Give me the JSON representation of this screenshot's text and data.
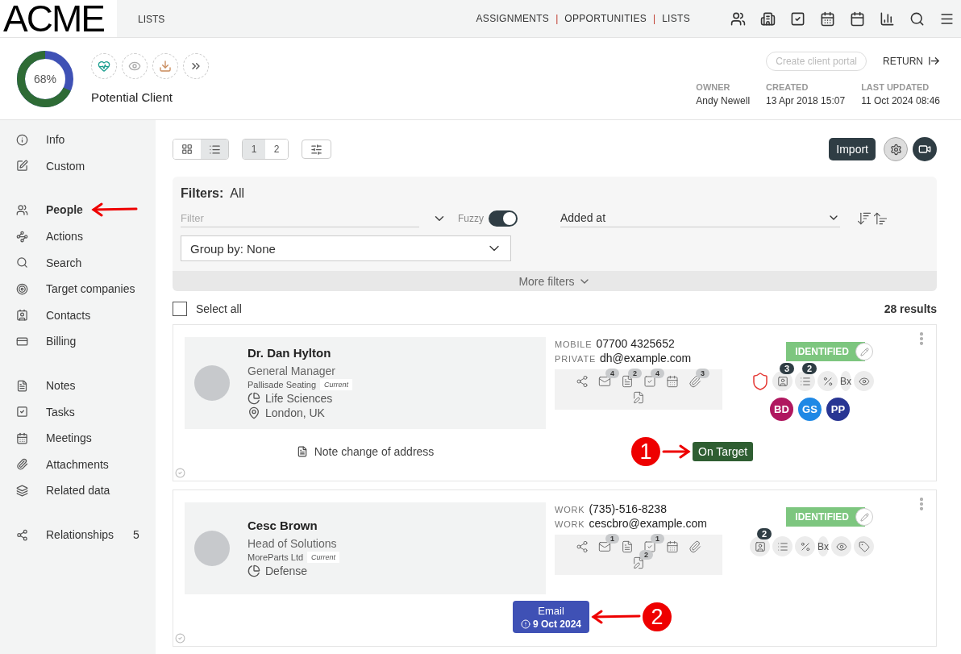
{
  "header": {
    "logo": "ACME",
    "section": "LISTS",
    "nav": [
      {
        "kind": "link",
        "label": "ASSIGNMENTS"
      },
      {
        "kind": "separator",
        "label": "|"
      },
      {
        "kind": "link",
        "label": "OPPORTUNITIES"
      },
      {
        "kind": "separator",
        "label": "|"
      },
      {
        "kind": "link",
        "label": "LISTS"
      }
    ]
  },
  "record": {
    "progress": {
      "level": 0.68,
      "reading": "68%"
    },
    "status": "Potential Client",
    "portal_button": {
      "label": "Create client portal",
      "disabled": true
    },
    "return_label": "RETURN",
    "meta": [
      {
        "label": "OWNER",
        "value": "Andy Newell"
      },
      {
        "label": "CREATED",
        "value": "13 Apr 2018 15:07"
      },
      {
        "label": "LAST UPDATED",
        "value": "11 Oct 2024 08:46"
      }
    ]
  },
  "sidebar": {
    "groups": [
      [
        {
          "label": "Info",
          "selected": false
        },
        {
          "label": "Custom",
          "selected": false
        }
      ],
      [
        {
          "label": "People",
          "selected": true,
          "annotated": true
        },
        {
          "label": "Actions",
          "selected": false
        },
        {
          "label": "Search",
          "selected": false
        },
        {
          "label": "Target companies",
          "selected": false
        },
        {
          "label": "Contacts",
          "selected": false
        },
        {
          "label": "Billing",
          "selected": false
        }
      ],
      [
        {
          "label": "Notes",
          "selected": false
        },
        {
          "label": "Tasks",
          "selected": false
        },
        {
          "label": "Meetings",
          "selected": false
        },
        {
          "label": "Attachments",
          "selected": false
        },
        {
          "label": "Related data",
          "selected": false
        }
      ],
      [
        {
          "label": "Relationships",
          "selected": false,
          "count": "5"
        }
      ]
    ]
  },
  "toolbar": {
    "views": [
      {
        "kind": "grid",
        "selected": false
      },
      {
        "kind": "list",
        "selected": true
      }
    ],
    "pages": [
      {
        "label": "1",
        "selected": true
      },
      {
        "label": "2",
        "selected": false
      }
    ],
    "import_label": "Import"
  },
  "filters": {
    "title": "Filters:",
    "value": "All",
    "filter_placeholder": "Filter",
    "fuzzy": {
      "label": "Fuzzy",
      "on": true
    },
    "sort": "Added at",
    "group_by": "Group by: None",
    "more_label": "More filters"
  },
  "select_all": {
    "label": "Select all",
    "checked": false
  },
  "results": "28 results",
  "people": [
    {
      "name": "Dr. Dan Hylton",
      "title": "General Manager",
      "company": "Pallisade Seating",
      "company_tag": "Current",
      "industry": "Life Sciences",
      "location": "London, UK",
      "contacts": [
        {
          "type": "MOBILE",
          "value": "07700 4325652"
        },
        {
          "type": "PRIVATE",
          "value": "dh@example.com"
        }
      ],
      "activity": [
        {
          "kind": "relationships"
        },
        {
          "kind": "email",
          "count": "4"
        },
        {
          "kind": "document",
          "count": "2"
        },
        {
          "kind": "task",
          "count": "4"
        },
        {
          "kind": "calendar"
        },
        {
          "kind": "attachment",
          "count": "3"
        },
        {
          "kind": "signature"
        }
      ],
      "status": "IDENTIFIED",
      "tags": [
        {
          "kind": "shield"
        },
        {
          "kind": "contact",
          "count": "3"
        },
        {
          "kind": "list",
          "count": "2"
        },
        {
          "kind": "percent"
        },
        {
          "kind": "text",
          "label": "Bx"
        },
        {
          "kind": "eye"
        }
      ],
      "owners": [
        {
          "initials": "BD",
          "color": "#b0175f"
        },
        {
          "initials": "GS",
          "color": "#1e88e5"
        },
        {
          "initials": "PP",
          "color": "#283593"
        }
      ],
      "note": "Note change of address",
      "action": {
        "kind": "badge",
        "label": "On Target"
      },
      "callout": {
        "number": "1",
        "kind": "points_right"
      }
    },
    {
      "name": "Cesc Brown",
      "title": "Head of Solutions",
      "company": "MoreParts Ltd",
      "company_tag": "Current",
      "industry": "Defense",
      "contacts": [
        {
          "type": "WORK",
          "value": "(735)-516-8238"
        },
        {
          "type": "WORK",
          "value": "cescbro@example.com"
        }
      ],
      "activity": [
        {
          "kind": "relationships"
        },
        {
          "kind": "email",
          "count": "1"
        },
        {
          "kind": "document"
        },
        {
          "kind": "task",
          "count": "1"
        },
        {
          "kind": "calendar"
        },
        {
          "kind": "attachment"
        },
        {
          "kind": "signature",
          "count": "2"
        }
      ],
      "status": "IDENTIFIED",
      "tags": [
        {
          "kind": "contact",
          "count": "2"
        },
        {
          "kind": "list"
        },
        {
          "kind": "percent"
        },
        {
          "kind": "text",
          "label": "Bx"
        },
        {
          "kind": "eye"
        },
        {
          "kind": "tag"
        }
      ],
      "action": {
        "kind": "task",
        "label": "Email",
        "date": "9 Oct 2024"
      },
      "callout": {
        "number": "2",
        "kind": "points_left"
      }
    }
  ]
}
